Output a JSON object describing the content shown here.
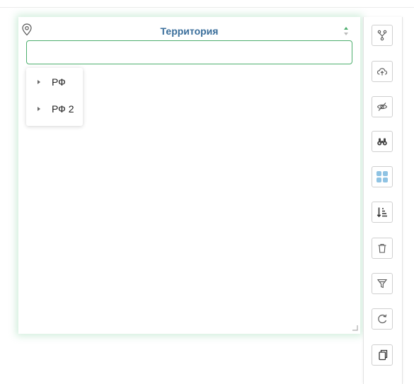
{
  "panel": {
    "title": "Территория",
    "search": {
      "value": "",
      "placeholder": ""
    },
    "tree_items": [
      {
        "label": "РФ"
      },
      {
        "label": "РФ 2"
      }
    ]
  },
  "toolbar": {
    "buttons": [
      {
        "icon": "branch-icon"
      },
      {
        "icon": "cloud-upload-icon"
      },
      {
        "icon": "eye-off-icon"
      },
      {
        "icon": "binoculars-icon"
      },
      {
        "icon": "grid-icon",
        "active": true
      },
      {
        "icon": "sort-icon"
      },
      {
        "icon": "trash-icon"
      },
      {
        "icon": "filter-icon"
      },
      {
        "icon": "refresh-icon"
      },
      {
        "icon": "copy-icon"
      }
    ]
  },
  "colors": {
    "title": "#3a6e9b",
    "input_border": "#4cae6d",
    "grid_icon": "#8fc3e3",
    "icon": "#555555"
  }
}
